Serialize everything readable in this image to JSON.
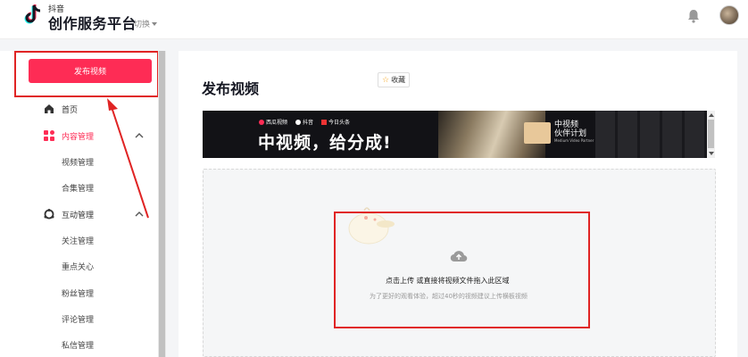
{
  "header": {
    "logo_small": "抖音",
    "logo_main": "创作服务平台",
    "switch_label": "切换"
  },
  "sidebar": {
    "publish_label": "发布视频",
    "items": [
      {
        "label": "首页",
        "icon": "home-icon"
      },
      {
        "label": "内容管理",
        "icon": "grid-icon",
        "active": true
      },
      {
        "label": "互动管理",
        "icon": "interaction-icon"
      }
    ],
    "content_sub": [
      "视频管理",
      "合集管理"
    ],
    "interaction_sub": [
      "关注管理",
      "重点关心",
      "粉丝管理",
      "评论管理",
      "私信管理"
    ]
  },
  "main": {
    "title": "发布视频",
    "favorite_label": "收藏",
    "banner": {
      "logos": [
        "西瓜视频",
        "抖音",
        "今日头条"
      ],
      "slogan": "中视频，给分成!",
      "plan_line1": "中视频",
      "plan_line2": "伙伴计划",
      "plan_en": "Medium Video Partner"
    },
    "upload": {
      "title": "点击上传 或直接将视频文件拖入此区域",
      "hint": "为了更好的观看体验，超过40秒的视频建议上传横板视频"
    }
  },
  "colors": {
    "brand": "#fe2c55",
    "annotation_red": "#e02424"
  }
}
